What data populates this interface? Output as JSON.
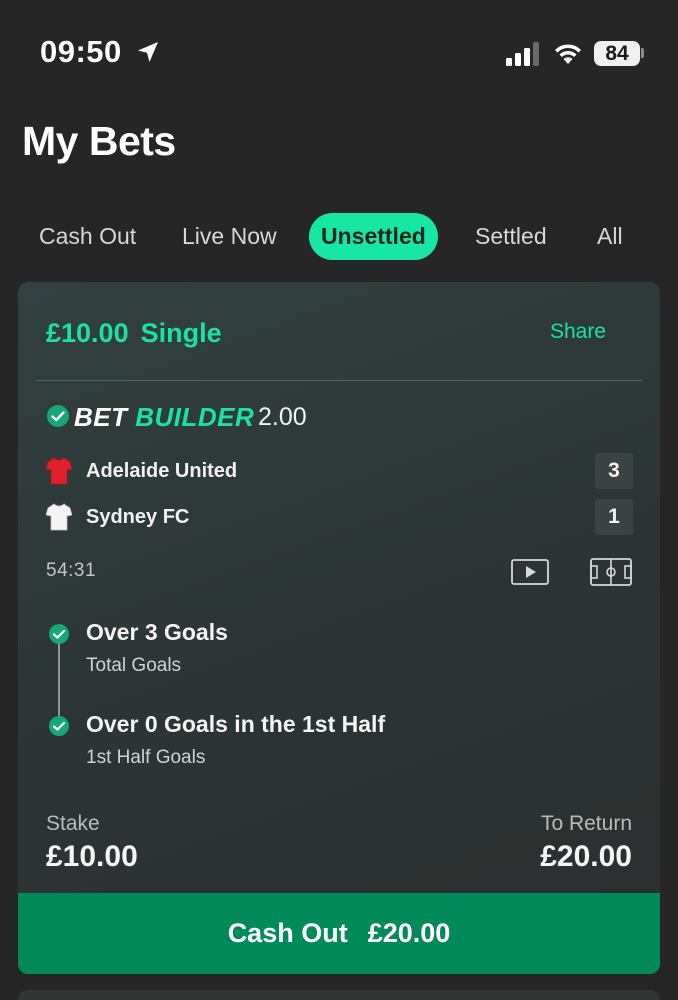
{
  "status_bar": {
    "time": "09:50",
    "battery": "84",
    "icons": [
      "location-arrow-icon",
      "signal-bars-icon",
      "wifi-icon",
      "battery-icon"
    ]
  },
  "page": {
    "title": "My Bets"
  },
  "tabs": [
    {
      "label": "Cash Out",
      "active": false
    },
    {
      "label": "Live Now",
      "active": false
    },
    {
      "label": "Unsettled",
      "active": true
    },
    {
      "label": "Settled",
      "active": false
    },
    {
      "label": "All",
      "active": false
    }
  ],
  "bet": {
    "stake_header": "£10.00",
    "bet_type": "Single",
    "share_label": "Share",
    "builder": {
      "logo_part1": "BET",
      "logo_part2": "BUILDER",
      "odds": "2.00"
    },
    "teams": [
      {
        "name": "Adelaide United",
        "score": "3",
        "shirt_color": "#e0202a",
        "shirt_icon": "red-shirt-icon"
      },
      {
        "name": "Sydney FC",
        "score": "1",
        "shirt_color": "#f4f4f4",
        "shirt_icon": "white-shirt-icon"
      }
    ],
    "match_time": "54:31",
    "selections": [
      {
        "title": "Over 3 Goals",
        "market": "Total Goals"
      },
      {
        "title": "Over 0 Goals in the 1st Half",
        "market": "1st Half Goals"
      }
    ],
    "stake_label": "Stake",
    "stake_value": "£10.00",
    "return_label": "To Return",
    "return_value": "£20.00",
    "cashout_label": "Cash Out",
    "cashout_value": "£20.00"
  },
  "colors": {
    "accent": "#19e3a3",
    "background": "#262626",
    "cashout_button": "#038a5b",
    "tab_active": "#18e6a5"
  }
}
